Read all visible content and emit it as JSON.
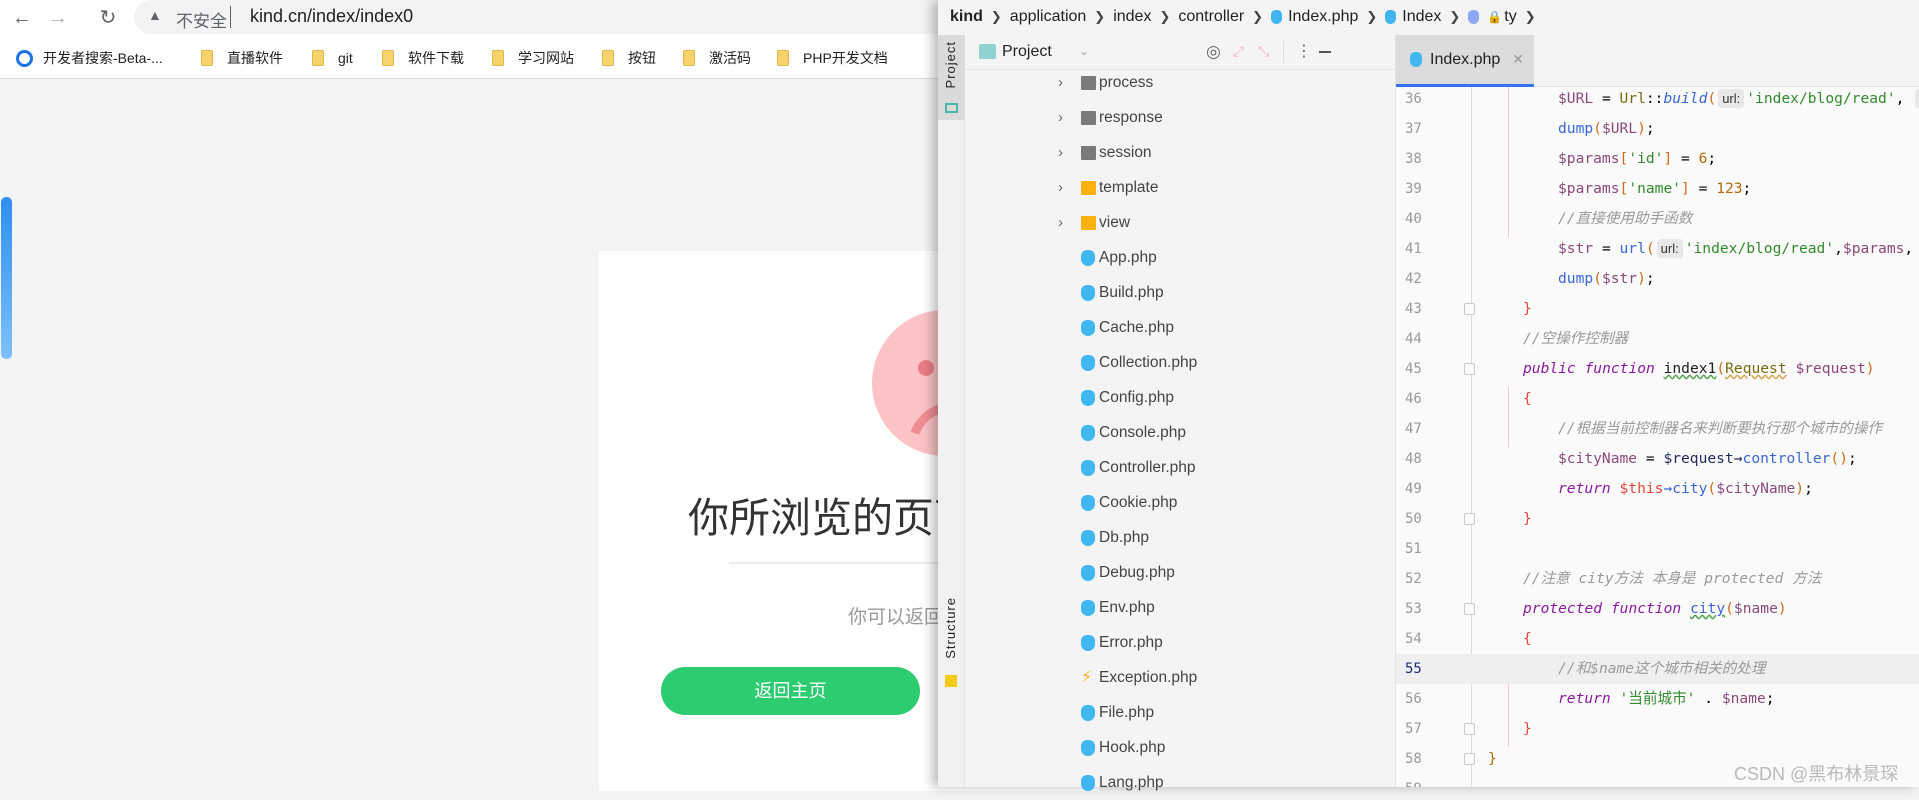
{
  "browser": {
    "nav": {
      "back": "←",
      "forward": "→",
      "reload": "↻"
    },
    "security_label": "不安全",
    "url": "kind.cn/index/index0",
    "bookmarks": [
      {
        "label": "开发者搜索-Beta-...",
        "icon": "search-logo-icon"
      },
      {
        "label": "直播软件",
        "icon": "folder-icon"
      },
      {
        "label": "git",
        "icon": "folder-icon"
      },
      {
        "label": "软件下载",
        "icon": "folder-icon"
      },
      {
        "label": "学习网站",
        "icon": "folder-icon"
      },
      {
        "label": "按钮",
        "icon": "folder-icon"
      },
      {
        "label": "激活码",
        "icon": "folder-icon"
      },
      {
        "label": "PHP开发文档",
        "icon": "folder-icon"
      }
    ]
  },
  "error_page": {
    "title": "你所浏览的页面",
    "subtitle": "你可以返回",
    "home_button": "返回主页",
    "accent_color": "#2ecc71"
  },
  "ide": {
    "breadcrumbs": [
      "kind",
      "application",
      "index",
      "controller",
      "Index.php",
      "Index",
      "ty"
    ],
    "tool_windows": {
      "project": "Project",
      "structure": "Structure"
    },
    "project_panel": {
      "title": "Project",
      "tree": [
        {
          "label": "process",
          "type": "folder"
        },
        {
          "label": "response",
          "type": "folder"
        },
        {
          "label": "session",
          "type": "folder"
        },
        {
          "label": "template",
          "type": "template-folder"
        },
        {
          "label": "view",
          "type": "template-folder"
        },
        {
          "label": "App.php",
          "type": "php"
        },
        {
          "label": "Build.php",
          "type": "php"
        },
        {
          "label": "Cache.php",
          "type": "php"
        },
        {
          "label": "Collection.php",
          "type": "php"
        },
        {
          "label": "Config.php",
          "type": "php"
        },
        {
          "label": "Console.php",
          "type": "php"
        },
        {
          "label": "Controller.php",
          "type": "php"
        },
        {
          "label": "Cookie.php",
          "type": "php"
        },
        {
          "label": "Db.php",
          "type": "php"
        },
        {
          "label": "Debug.php",
          "type": "php"
        },
        {
          "label": "Env.php",
          "type": "php"
        },
        {
          "label": "Error.php",
          "type": "php"
        },
        {
          "label": "Exception.php",
          "type": "exception"
        },
        {
          "label": "File.php",
          "type": "php"
        },
        {
          "label": "Hook.php",
          "type": "php"
        },
        {
          "label": "Lang.php",
          "type": "php"
        }
      ]
    },
    "active_tab": "Index.php",
    "current_line": 55,
    "code": [
      {
        "n": "36",
        "indent": 2,
        "tokens": [
          [
            "$URL",
            "v"
          ],
          [
            " = ",
            ""
          ],
          [
            "Url",
            "cls"
          ],
          [
            "::",
            ""
          ],
          [
            "build",
            "fi"
          ],
          [
            "(",
            "p"
          ],
          [
            "url:",
            "inlay"
          ],
          [
            "'index/blog/read'",
            "s"
          ],
          [
            ", ",
            ""
          ],
          [
            "v",
            "inlay"
          ]
        ]
      },
      {
        "n": "37",
        "indent": 2,
        "tokens": [
          [
            "dump",
            "f"
          ],
          [
            "(",
            "p"
          ],
          [
            "$URL",
            "v"
          ],
          [
            ")",
            "p"
          ],
          [
            ";",
            ""
          ]
        ]
      },
      {
        "n": "38",
        "indent": 2,
        "tokens": [
          [
            "$params",
            "v"
          ],
          [
            "[",
            "p"
          ],
          [
            "'id'",
            "s"
          ],
          [
            "]",
            "p"
          ],
          [
            " = ",
            ""
          ],
          [
            "6",
            "n"
          ],
          [
            ";",
            ""
          ]
        ]
      },
      {
        "n": "39",
        "indent": 2,
        "tokens": [
          [
            "$params",
            "v"
          ],
          [
            "[",
            "p"
          ],
          [
            "'name'",
            "s"
          ],
          [
            "]",
            "p"
          ],
          [
            " = ",
            ""
          ],
          [
            "123",
            "n"
          ],
          [
            ";",
            ""
          ]
        ]
      },
      {
        "n": "40",
        "indent": 2,
        "tokens": [
          [
            "//直接使用助手函数",
            "c"
          ]
        ]
      },
      {
        "n": "41",
        "indent": 2,
        "tokens": [
          [
            "$str",
            "v"
          ],
          [
            " = ",
            ""
          ],
          [
            "url",
            "f"
          ],
          [
            "(",
            "p"
          ],
          [
            "url:",
            "inlay"
          ],
          [
            "'index/blog/read'",
            "s"
          ],
          [
            ",",
            ""
          ],
          [
            "$params",
            "v"
          ],
          [
            ",",
            ""
          ]
        ]
      },
      {
        "n": "42",
        "indent": 2,
        "tokens": [
          [
            "dump",
            "f"
          ],
          [
            "(",
            "p"
          ],
          [
            "$str",
            "v"
          ],
          [
            ")",
            "p"
          ],
          [
            ";",
            ""
          ]
        ]
      },
      {
        "n": "43",
        "indent": 1,
        "fold": true,
        "tokens": [
          [
            "}",
            "b"
          ]
        ]
      },
      {
        "n": "44",
        "indent": 1,
        "tokens": [
          [
            "//空操作控制器",
            "c"
          ]
        ]
      },
      {
        "n": "45",
        "indent": 1,
        "fold": true,
        "tokens": [
          [
            "public",
            "k"
          ],
          [
            " ",
            ""
          ],
          [
            "function",
            "k"
          ],
          [
            " ",
            ""
          ],
          [
            "index1",
            "fn"
          ],
          [
            "(",
            "p"
          ],
          [
            "Request",
            "req"
          ],
          [
            " ",
            ""
          ],
          [
            "$request",
            "v"
          ],
          [
            ")",
            "p"
          ]
        ]
      },
      {
        "n": "46",
        "indent": 1,
        "tokens": [
          [
            "{",
            "b"
          ]
        ]
      },
      {
        "n": "47",
        "indent": 2,
        "tokens": [
          [
            "//根据当前控制器名来判断要执行那个城市的操作",
            "c"
          ]
        ]
      },
      {
        "n": "48",
        "indent": 2,
        "tokens": [
          [
            "$cityName",
            "v"
          ],
          [
            " = ",
            ""
          ],
          [
            "$request",
            "o"
          ],
          [
            "→",
            "o"
          ],
          [
            "controller",
            "f"
          ],
          [
            "()",
            "p"
          ],
          [
            ";",
            ""
          ]
        ]
      },
      {
        "n": "49",
        "indent": 2,
        "tokens": [
          [
            "return",
            "k"
          ],
          [
            " ",
            ""
          ],
          [
            "$this",
            "b"
          ],
          [
            "→",
            "f"
          ],
          [
            "city",
            "f"
          ],
          [
            "(",
            "p"
          ],
          [
            "$cityName",
            "v"
          ],
          [
            ")",
            "p"
          ],
          [
            ";",
            ""
          ]
        ]
      },
      {
        "n": "50",
        "indent": 1,
        "fold": true,
        "tokens": [
          [
            "}",
            "b"
          ]
        ]
      },
      {
        "n": "51",
        "indent": 0,
        "tokens": []
      },
      {
        "n": "52",
        "indent": 1,
        "tokens": [
          [
            "//注意 city方法 本身是 protected 方法",
            "c"
          ]
        ]
      },
      {
        "n": "53",
        "indent": 1,
        "fold": true,
        "tokens": [
          [
            "protected",
            "k"
          ],
          [
            " ",
            ""
          ],
          [
            "function",
            "k"
          ],
          [
            " ",
            ""
          ],
          [
            "city",
            "cy"
          ],
          [
            "(",
            "p"
          ],
          [
            "$name",
            "v"
          ],
          [
            ")",
            "p"
          ]
        ]
      },
      {
        "n": "54",
        "indent": 1,
        "tokens": [
          [
            "{",
            "b"
          ]
        ]
      },
      {
        "n": "55",
        "indent": 2,
        "tokens": [
          [
            "//和$name这个城市相关的处理",
            "c"
          ]
        ]
      },
      {
        "n": "56",
        "indent": 2,
        "tokens": [
          [
            "return",
            "k"
          ],
          [
            " ",
            ""
          ],
          [
            "'当前城市'",
            "s"
          ],
          [
            " . ",
            ""
          ],
          [
            "$name",
            "v"
          ],
          [
            ";",
            ""
          ]
        ]
      },
      {
        "n": "57",
        "indent": 1,
        "fold": true,
        "tokens": [
          [
            "}",
            "b"
          ]
        ]
      },
      {
        "n": "58",
        "indent": 0,
        "fold": true,
        "tokens": [
          [
            "}",
            "n"
          ]
        ]
      },
      {
        "n": "59",
        "indent": 0,
        "tokens": []
      }
    ]
  },
  "watermark": "CSDN @黑布林景琛"
}
